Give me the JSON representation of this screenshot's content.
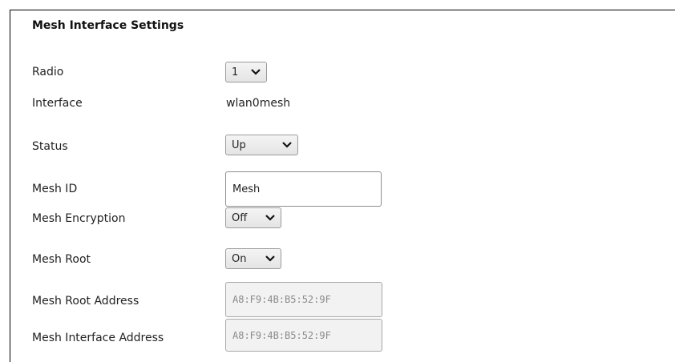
{
  "section": {
    "title": "Mesh Interface Settings"
  },
  "rows": {
    "radio": {
      "label": "Radio",
      "value": "1"
    },
    "interface": {
      "label": "Interface",
      "value": "wlan0mesh"
    },
    "status": {
      "label": "Status",
      "value": "Up"
    },
    "mesh_id": {
      "label": "Mesh ID",
      "value": "Mesh"
    },
    "mesh_encryption": {
      "label": "Mesh Encryption",
      "value": "Off"
    },
    "mesh_root": {
      "label": "Mesh Root",
      "value": "On"
    },
    "mesh_root_address": {
      "label": "Mesh Root Address",
      "value": "A8:F9:4B:B5:52:9F"
    },
    "mesh_interface_address": {
      "label": "Mesh Interface Address",
      "value": "A8:F9:4B:B5:52:9F"
    }
  },
  "icons": {
    "dropdown": "chevron-down-icon"
  }
}
